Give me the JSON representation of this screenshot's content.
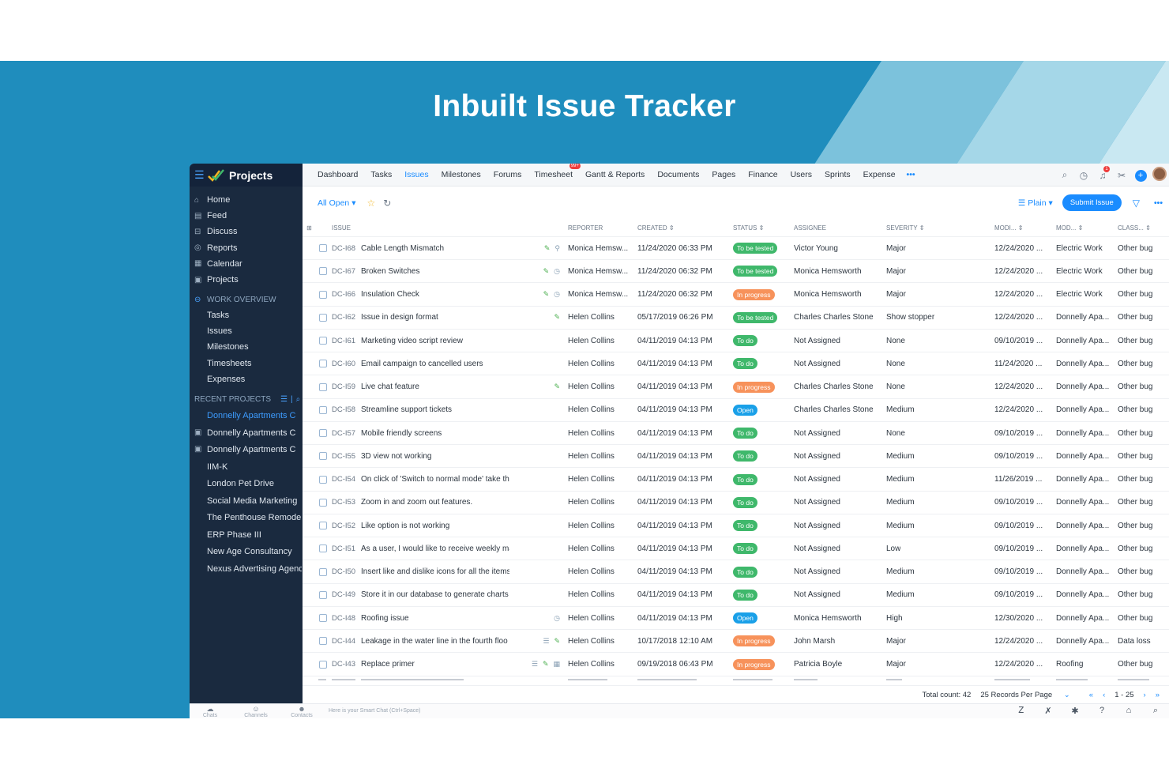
{
  "banner": {
    "title": "Inbuilt Issue Tracker"
  },
  "colors": {
    "banner_bg": "#1f8dbd",
    "sidebar_bg": "#1a2a3f",
    "accent": "#1a8cff",
    "status_to_be_tested": "#3fb86b",
    "status_in_progress": "#f7925b",
    "status_to_do": "#3fb86b",
    "status_open": "#1aa0e8"
  },
  "app": {
    "name": "Projects"
  },
  "sidebar": {
    "main": [
      {
        "label": "Home",
        "icon": "home-icon"
      },
      {
        "label": "Feed",
        "icon": "feed-icon"
      },
      {
        "label": "Discuss",
        "icon": "discuss-icon"
      },
      {
        "label": "Reports",
        "icon": "reports-icon"
      },
      {
        "label": "Calendar",
        "icon": "calendar-icon"
      },
      {
        "label": "Projects",
        "icon": "projects-icon"
      }
    ],
    "work_overview_title": "WORK OVERVIEW",
    "work_overview": [
      "Tasks",
      "Issues",
      "Milestones",
      "Timesheets",
      "Expenses"
    ],
    "recent_projects_title": "RECENT PROJECTS",
    "recent_projects": [
      "Donnelly Apartments C",
      "Donnelly Apartments C",
      "Donnelly Apartments C",
      "IIM-K",
      "London Pet Drive",
      "Social Media Marketing",
      "The Penthouse Remodel",
      "ERP Phase III",
      "New Age Consultancy",
      "Nexus Advertising Agency"
    ]
  },
  "topnav": {
    "tabs": [
      "Dashboard",
      "Tasks",
      "Issues",
      "Milestones",
      "Forums",
      "Timesheet",
      "Gantt & Reports",
      "Documents",
      "Pages",
      "Finance",
      "Users",
      "Sprints",
      "Expense"
    ],
    "active_tab": "Issues",
    "timesheet_badge": "99+",
    "more": "•••",
    "notification_count": "1"
  },
  "toolbar": {
    "filter_label": "All Open",
    "view_label": "Plain",
    "submit_label": "Submit Issue",
    "more": "•••"
  },
  "table": {
    "headers": {
      "issue": "ISSUE",
      "reporter": "REPORTER",
      "created": "CREATED",
      "status": "STATUS",
      "assignee": "ASSIGNEE",
      "severity": "SEVERITY",
      "modified": "MODI...",
      "module": "MOD...",
      "classification": "CLASS..."
    },
    "rows": [
      {
        "key": "DC-I68",
        "title": "Cable Length Mismatch",
        "icons": [
          "edit-icon",
          "link-icon"
        ],
        "reporter": "Monica Hemsw...",
        "created": "11/24/2020 06:33 PM",
        "status": "To be tested",
        "status_color": "#3fb86b",
        "assignee": "Victor Young",
        "severity": "Major",
        "modified": "12/24/2020 ...",
        "module": "Electric Work",
        "classification": "Other bug"
      },
      {
        "key": "DC-I67",
        "title": "Broken Switches",
        "icons": [
          "edit-icon",
          "timer-icon"
        ],
        "reporter": "Monica Hemsw...",
        "created": "11/24/2020 06:32 PM",
        "status": "To be tested",
        "status_color": "#3fb86b",
        "assignee": "Monica Hemsworth",
        "severity": "Major",
        "modified": "12/24/2020 ...",
        "module": "Electric Work",
        "classification": "Other bug"
      },
      {
        "key": "DC-I66",
        "title": "Insulation Check",
        "icons": [
          "edit-icon",
          "timer-icon"
        ],
        "reporter": "Monica Hemsw...",
        "created": "11/24/2020 06:32 PM",
        "status": "In progress",
        "status_color": "#f7925b",
        "assignee": "Monica Hemsworth",
        "severity": "Major",
        "modified": "12/24/2020 ...",
        "module": "Electric Work",
        "classification": "Other bug"
      },
      {
        "key": "DC-I62",
        "title": "Issue in design format",
        "icons": [
          "edit-icon"
        ],
        "reporter": "Helen Collins",
        "created": "05/17/2019 06:26 PM",
        "status": "To be tested",
        "status_color": "#3fb86b",
        "assignee": "Charles Charles Stone",
        "severity": "Show stopper",
        "modified": "12/24/2020 ...",
        "module": "Donnelly Apa...",
        "classification": "Other bug"
      },
      {
        "key": "DC-I61",
        "title": "Marketing video script review",
        "icons": [],
        "reporter": "Helen Collins",
        "created": "04/11/2019 04:13 PM",
        "status": "To do",
        "status_color": "#3fb86b",
        "assignee": "Not Assigned",
        "severity": "None",
        "modified": "09/10/2019 ...",
        "module": "Donnelly Apa...",
        "classification": "Other bug"
      },
      {
        "key": "DC-I60",
        "title": "Email campaign to cancelled users",
        "icons": [],
        "reporter": "Helen Collins",
        "created": "04/11/2019 04:13 PM",
        "status": "To do",
        "status_color": "#3fb86b",
        "assignee": "Not Assigned",
        "severity": "None",
        "modified": "11/24/2020 ...",
        "module": "Donnelly Apa...",
        "classification": "Other bug"
      },
      {
        "key": "DC-I59",
        "title": "Live chat feature",
        "icons": [
          "edit-icon"
        ],
        "reporter": "Helen Collins",
        "created": "04/11/2019 04:13 PM",
        "status": "In progress",
        "status_color": "#f7925b",
        "assignee": "Charles Charles Stone",
        "severity": "None",
        "modified": "12/24/2020 ...",
        "module": "Donnelly Apa...",
        "classification": "Other bug"
      },
      {
        "key": "DC-I58",
        "title": "Streamline support tickets",
        "icons": [],
        "reporter": "Helen Collins",
        "created": "04/11/2019 04:13 PM",
        "status": "Open",
        "status_color": "#1aa0e8",
        "assignee": "Charles Charles Stone",
        "severity": "Medium",
        "modified": "12/24/2020 ...",
        "module": "Donnelly Apa...",
        "classification": "Other bug"
      },
      {
        "key": "DC-I57",
        "title": "Mobile friendly screens",
        "icons": [],
        "reporter": "Helen Collins",
        "created": "04/11/2019 04:13 PM",
        "status": "To do",
        "status_color": "#3fb86b",
        "assignee": "Not Assigned",
        "severity": "None",
        "modified": "09/10/2019 ...",
        "module": "Donnelly Apa...",
        "classification": "Other bug"
      },
      {
        "key": "DC-I55",
        "title": "3D view not working",
        "icons": [],
        "reporter": "Helen Collins",
        "created": "04/11/2019 04:13 PM",
        "status": "To do",
        "status_color": "#3fb86b",
        "assignee": "Not Assigned",
        "severity": "Medium",
        "modified": "09/10/2019 ...",
        "module": "Donnelly Apa...",
        "classification": "Other bug"
      },
      {
        "key": "DC-I54",
        "title": "On click of 'Switch to normal mode' take th",
        "icons": [],
        "reporter": "Helen Collins",
        "created": "04/11/2019 04:13 PM",
        "status": "To do",
        "status_color": "#3fb86b",
        "assignee": "Not Assigned",
        "severity": "Medium",
        "modified": "11/26/2019 ...",
        "module": "Donnelly Apa...",
        "classification": "Other bug"
      },
      {
        "key": "DC-I53",
        "title": "Zoom in and zoom out features.",
        "icons": [],
        "reporter": "Helen Collins",
        "created": "04/11/2019 04:13 PM",
        "status": "To do",
        "status_color": "#3fb86b",
        "assignee": "Not Assigned",
        "severity": "Medium",
        "modified": "09/10/2019 ...",
        "module": "Donnelly Apa...",
        "classification": "Other bug"
      },
      {
        "key": "DC-I52",
        "title": "Like option is not working",
        "icons": [],
        "reporter": "Helen Collins",
        "created": "04/11/2019 04:13 PM",
        "status": "To do",
        "status_color": "#3fb86b",
        "assignee": "Not Assigned",
        "severity": "Medium",
        "modified": "09/10/2019 ...",
        "module": "Donnelly Apa...",
        "classification": "Other bug"
      },
      {
        "key": "DC-I51",
        "title": "As a user, I would like to receive weekly ma",
        "icons": [],
        "reporter": "Helen Collins",
        "created": "04/11/2019 04:13 PM",
        "status": "To do",
        "status_color": "#3fb86b",
        "assignee": "Not Assigned",
        "severity": "Low",
        "modified": "09/10/2019 ...",
        "module": "Donnelly Apa...",
        "classification": "Other bug"
      },
      {
        "key": "DC-I50",
        "title": "Insert like and dislike icons for all the items",
        "icons": [],
        "reporter": "Helen Collins",
        "created": "04/11/2019 04:13 PM",
        "status": "To do",
        "status_color": "#3fb86b",
        "assignee": "Not Assigned",
        "severity": "Medium",
        "modified": "09/10/2019 ...",
        "module": "Donnelly Apa...",
        "classification": "Other bug"
      },
      {
        "key": "DC-I49",
        "title": "Store it in our database to generate charts",
        "icons": [],
        "reporter": "Helen Collins",
        "created": "04/11/2019 04:13 PM",
        "status": "To do",
        "status_color": "#3fb86b",
        "assignee": "Not Assigned",
        "severity": "Medium",
        "modified": "09/10/2019 ...",
        "module": "Donnelly Apa...",
        "classification": "Other bug"
      },
      {
        "key": "DC-I48",
        "title": "Roofing issue",
        "icons": [
          "timer-icon"
        ],
        "reporter": "Helen Collins",
        "created": "04/11/2019 04:13 PM",
        "status": "Open",
        "status_color": "#1aa0e8",
        "assignee": "Monica Hemsworth",
        "severity": "High",
        "modified": "12/30/2020 ...",
        "module": "Donnelly Apa...",
        "classification": "Other bug"
      },
      {
        "key": "DC-I44",
        "title": "Leakage in the water line in the fourth floo",
        "icons": [
          "comment-icon",
          "edit-icon"
        ],
        "reporter": "Helen Collins",
        "created": "10/17/2018 12:10 AM",
        "status": "In progress",
        "status_color": "#f7925b",
        "assignee": "John Marsh",
        "severity": "Major",
        "modified": "12/24/2020 ...",
        "module": "Donnelly Apa...",
        "classification": "Data loss"
      },
      {
        "key": "DC-I43",
        "title": "Replace primer",
        "icons": [
          "comment-icon",
          "edit-icon",
          "calendar-icon"
        ],
        "reporter": "Helen Collins",
        "created": "09/19/2018 06:43 PM",
        "status": "In progress",
        "status_color": "#f7925b",
        "assignee": "Patricia Boyle",
        "severity": "Major",
        "modified": "12/24/2020 ...",
        "module": "Roofing",
        "classification": "Other bug"
      }
    ]
  },
  "footer": {
    "total": "Total count: 42",
    "per_page": "25 Records Per Page",
    "range": "1 - 25"
  },
  "bottom_bar": {
    "items": [
      "Chats",
      "Channels",
      "Contacts"
    ],
    "chat_placeholder": "Here is your Smart Chat (Ctrl+Space)"
  }
}
